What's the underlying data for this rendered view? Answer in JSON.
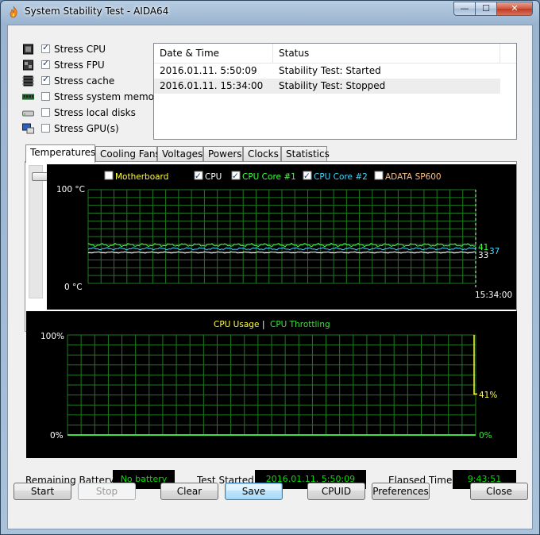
{
  "window": {
    "title": "System Stability Test - AIDA64"
  },
  "titlebar": {
    "min": "—",
    "max": "☐",
    "close": "✕"
  },
  "stress_options": [
    {
      "label": "Stress CPU",
      "checked": true,
      "icon": "cpu-chip-icon"
    },
    {
      "label": "Stress FPU",
      "checked": true,
      "icon": "fpu-chip-icon"
    },
    {
      "label": "Stress cache",
      "checked": true,
      "icon": "cache-chip-icon"
    },
    {
      "label": "Stress system memory",
      "checked": false,
      "icon": "memory-module-icon"
    },
    {
      "label": "Stress local disks",
      "checked": false,
      "icon": "hard-disk-icon"
    },
    {
      "label": "Stress GPU(s)",
      "checked": false,
      "icon": "gpu-monitor-icon"
    }
  ],
  "log": {
    "columns": [
      "Date & Time",
      "Status"
    ],
    "rows": [
      [
        "2016.01.11. 5:50:09",
        "Stability Test: Started"
      ],
      [
        "2016.01.11. 15:34:00",
        "Stability Test: Stopped"
      ]
    ]
  },
  "tabs": [
    "Temperatures",
    "Cooling Fans",
    "Voltages",
    "Powers",
    "Clocks",
    "Statistics"
  ],
  "active_tab": "Temperatures",
  "temp_graph": {
    "legend": [
      {
        "label": "Motherboard",
        "checked": false,
        "color": "#ffff40"
      },
      {
        "label": "CPU",
        "checked": true,
        "color": "#ffffff"
      },
      {
        "label": "CPU Core #1",
        "checked": true,
        "color": "#40ff40"
      },
      {
        "label": "CPU Core #2",
        "checked": true,
        "color": "#40d8ff"
      },
      {
        "label": "ADATA SP600",
        "checked": false,
        "color": "#ffc080"
      }
    ],
    "y_max_label": "100 °C",
    "y_min_label": "0 °C",
    "time_label": "15:34:00",
    "ylim": [
      0,
      100
    ],
    "series_levels": {
      "cpu": 33,
      "core1": 41,
      "core2": 37
    },
    "value_labels": {
      "core1": "41",
      "core2": "37",
      "cpu": "33"
    }
  },
  "usage_graph": {
    "legend": [
      {
        "label": "CPU Usage",
        "color": "#ffff40"
      },
      {
        "label": "CPU Throttling",
        "color": "#40e040"
      }
    ],
    "separator": "|",
    "y_max_label": "100%",
    "y_min_label": "0%",
    "usage_value": "41%",
    "throttle_value": "0%",
    "levels": {
      "usage_before": 100,
      "usage_end": 41,
      "throttle": 0
    }
  },
  "status": {
    "battery_label": "Remaining Battery:",
    "battery_value": "No battery",
    "started_label": "Test Started:",
    "started_value": "2016.01.11. 5:50:09",
    "elapsed_label": "Elapsed Time:",
    "elapsed_value": "9:43:51"
  },
  "buttons": {
    "start": "Start",
    "stop": "Stop",
    "clear": "Clear",
    "save": "Save",
    "cpuid": "CPUID",
    "preferences": "Preferences",
    "close": "Close"
  },
  "colors": {
    "graph_grid": "#1f7a1f",
    "graph_bg": "#000000",
    "status_text": "#00e000"
  }
}
